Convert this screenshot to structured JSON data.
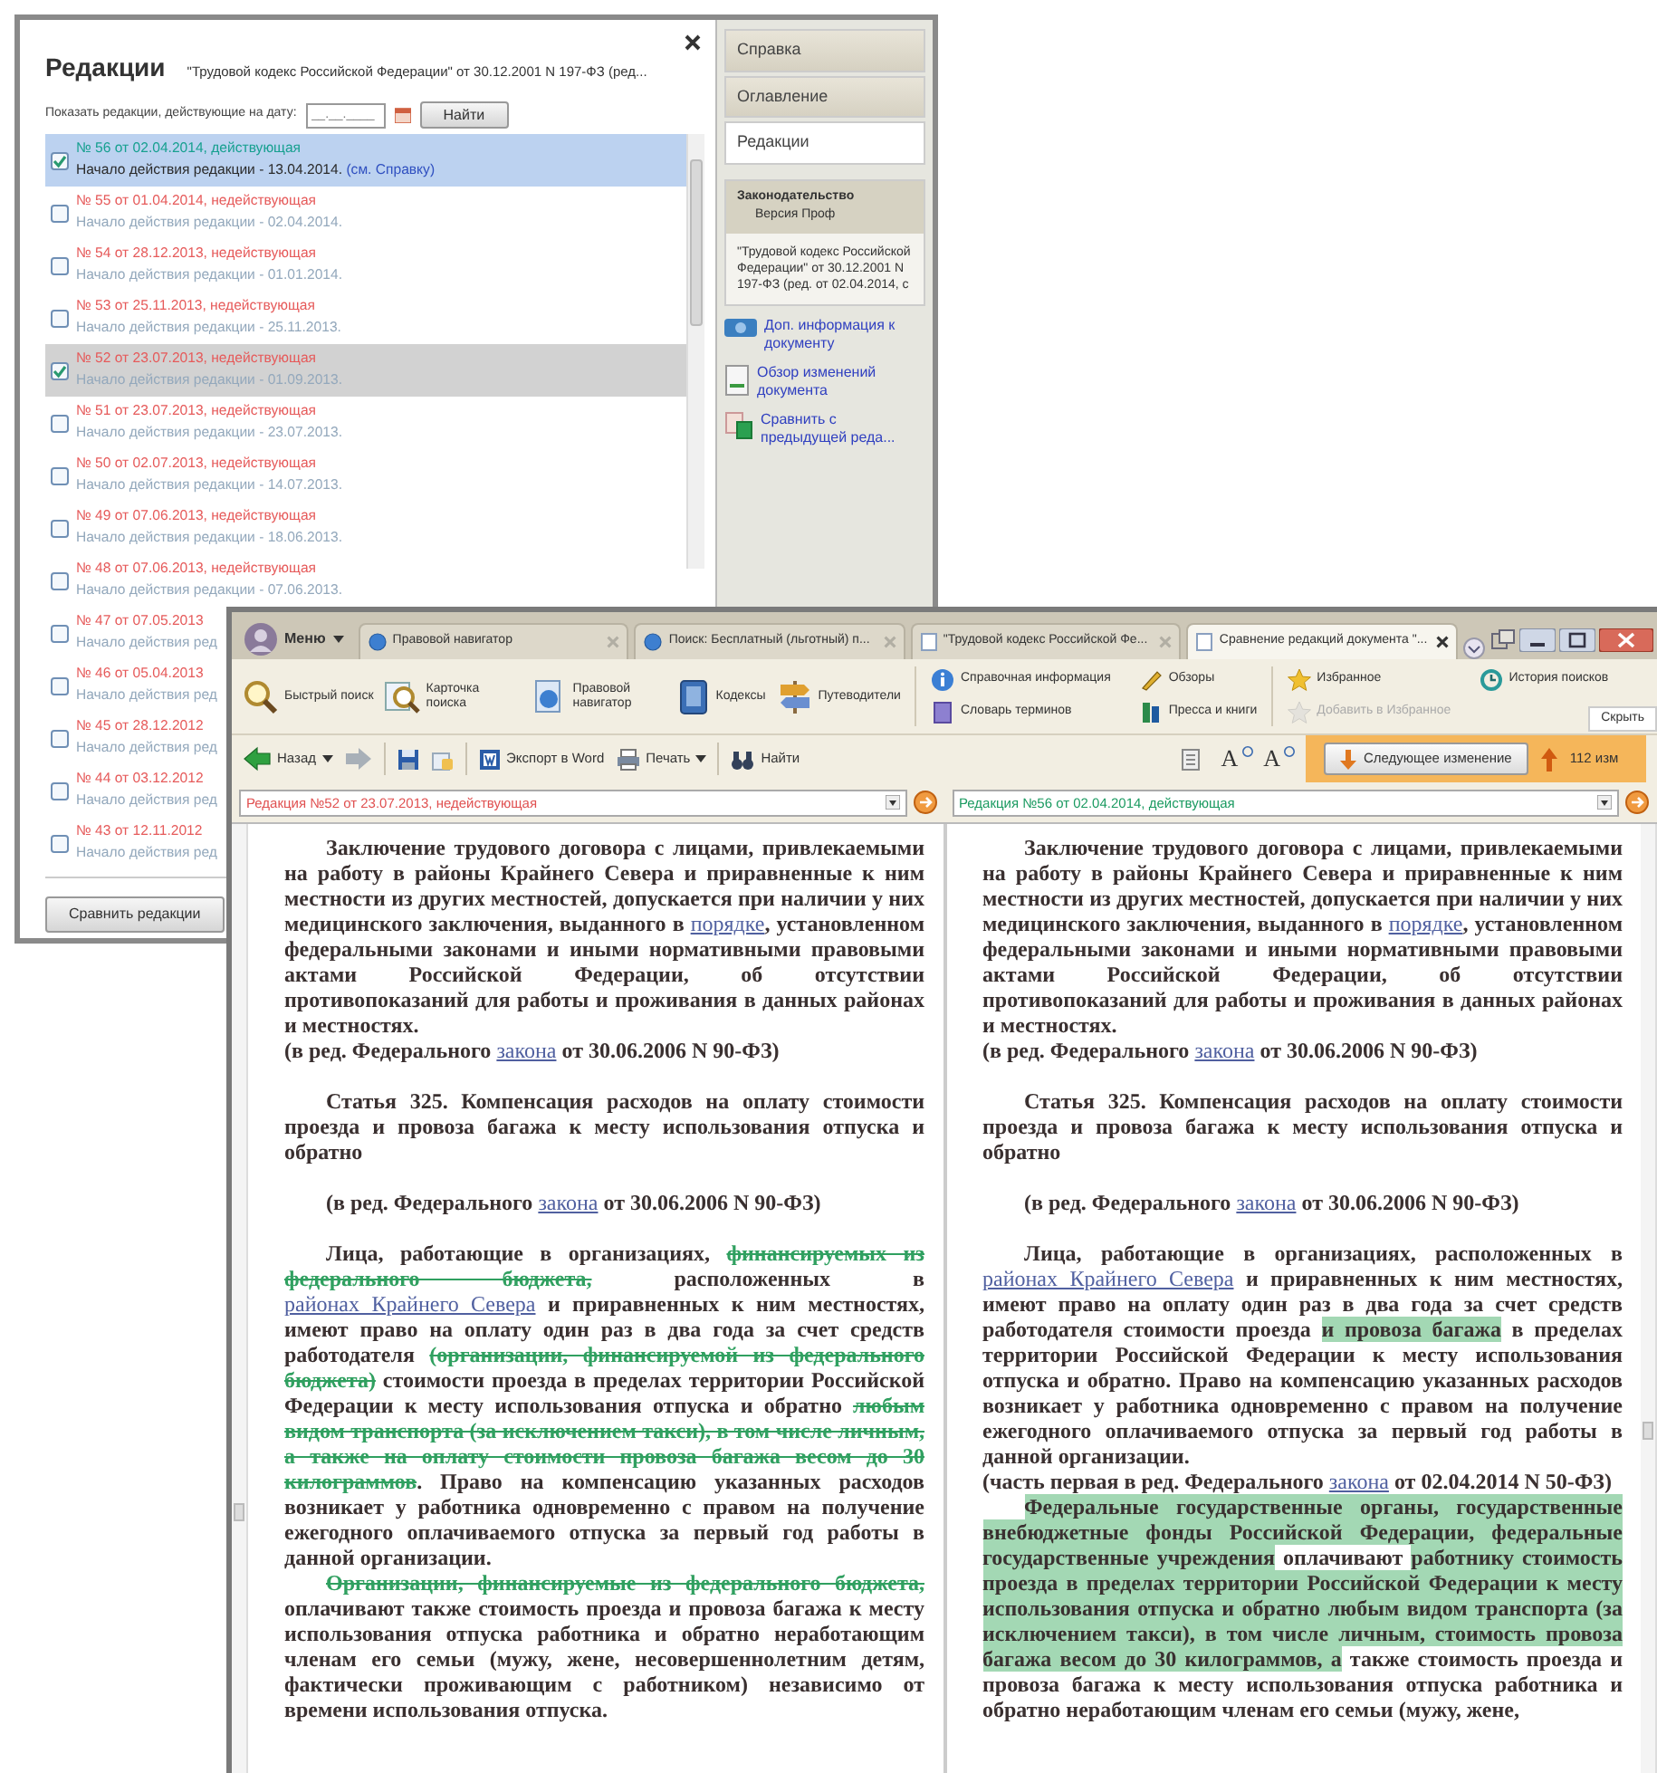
{
  "back_window": {
    "title": "Редакции",
    "document_title": "\"Трудовой кодекс Российской Федерации\" от 30.12.2001 N 197-ФЗ (ред...",
    "filter": {
      "label": "Показать редакции, действующие на дату:",
      "placeholder": "__.__.____",
      "button": "Найти"
    },
    "editions": [
      {
        "title": "№ 56 от 02.04.2014, действующая",
        "start": "Начало действия редакции - 13.04.2014.",
        "note": "(см. Справку)",
        "current": true,
        "checked": true,
        "selected": true
      },
      {
        "title": "№ 55 от 01.04.2014, недействующая",
        "start": "Начало действия редакции - 02.04.2014.",
        "current": false,
        "checked": false,
        "selected": false
      },
      {
        "title": "№ 54 от 28.12.2013, недействующая",
        "start": "Начало действия редакции - 01.01.2014.",
        "current": false,
        "checked": false,
        "selected": false
      },
      {
        "title": "№ 53 от 25.11.2013, недействующая",
        "start": "Начало действия редакции - 25.11.2013.",
        "current": false,
        "checked": false,
        "selected": false
      },
      {
        "title": "№ 52 от 23.07.2013, недействующая",
        "start": "Начало действия редакции - 01.09.2013.",
        "current": false,
        "checked": true,
        "selected": false
      },
      {
        "title": "№ 51 от 23.07.2013, недействующая",
        "start": "Начало действия редакции - 23.07.2013.",
        "current": false,
        "checked": false,
        "selected": false
      },
      {
        "title": "№ 50 от 02.07.2013, недействующая",
        "start": "Начало действия редакции - 14.07.2013.",
        "current": false,
        "checked": false,
        "selected": false
      },
      {
        "title": "№ 49 от 07.06.2013, недействующая",
        "start": "Начало действия редакции - 18.06.2013.",
        "current": false,
        "checked": false,
        "selected": false
      },
      {
        "title": "№ 48 от 07.06.2013, недействующая",
        "start": "Начало действия редакции - 07.06.2013.",
        "current": false,
        "checked": false,
        "selected": false
      },
      {
        "title": "№ 47 от 07.05.2013",
        "start": "Начало действия ред",
        "current": false,
        "checked": false,
        "selected": false
      },
      {
        "title": "№ 46 от 05.04.2013",
        "start": "Начало действия ред",
        "current": false,
        "checked": false,
        "selected": false
      },
      {
        "title": "№ 45 от 28.12.2012",
        "start": "Начало действия ред",
        "current": false,
        "checked": false,
        "selected": false
      },
      {
        "title": "№ 44 от 03.12.2012",
        "start": "Начало действия ред",
        "current": false,
        "checked": false,
        "selected": false
      },
      {
        "title": "№ 43 от 12.11.2012",
        "start": "Начало действия ред",
        "current": false,
        "checked": false,
        "selected": false
      }
    ],
    "compare_button": "Сравнить редакции",
    "side_tabs": [
      {
        "label": "Справка",
        "selected": false
      },
      {
        "label": "Оглавление",
        "selected": false
      },
      {
        "label": "Редакции",
        "selected": true
      }
    ],
    "info": {
      "header": "Законодательство",
      "subheader": "Версия Проф",
      "text": "\"Трудовой кодекс Российской Федерации\" от 30.12.2001 N 197-ФЗ (ред. от 02.04.2014, с"
    },
    "links": [
      "Доп. информация к документу",
      "Обзор изменений документа",
      "Сравнить с предыдущей реда..."
    ]
  },
  "main_window": {
    "menu_button": "Меню",
    "tabs": [
      {
        "label": "Правовой навигатор",
        "selected": false
      },
      {
        "label": "Поиск: Бесплатный (льготный) п...",
        "selected": false
      },
      {
        "label": "\"Трудовой кодекс Российской Фе...",
        "selected": false
      },
      {
        "label": "Сравнение редакций документа \"...",
        "selected": true
      }
    ],
    "ribbon": {
      "large": [
        "Быстрый поиск",
        "Карточка поиска",
        "Правовой навигатор",
        "Кодексы",
        "Путеводители"
      ],
      "small": [
        {
          "label": "Справочная информация",
          "disabled": false
        },
        {
          "label": "Словарь терминов",
          "disabled": false
        },
        {
          "label": "Обзоры",
          "disabled": false
        },
        {
          "label": "Пресса и книги",
          "disabled": false
        },
        {
          "label": "Избранное",
          "disabled": false
        },
        {
          "label": "Добавить в Избранное",
          "disabled": true
        },
        {
          "label": "История поисков",
          "disabled": false
        }
      ],
      "hide": "Скрыть"
    },
    "toolbar": {
      "back": "Назад",
      "export": "Экспорт в Word",
      "print": "Печать",
      "find": "Найти",
      "font_buttons": [
        "A",
        "A"
      ],
      "next_change": "Следующее изменение",
      "changes_count": "112 изм"
    },
    "panes": [
      {
        "edition": "Редакция №52 от 23.07.2013, недействующая",
        "current": false,
        "paragraphs": [
          {
            "indent": true,
            "gap_before": false,
            "parts": [
              {
                "kind": "text",
                "text": "Заключение трудового договора с лицами, привлекаемыми на работу в районы Крайнего Севера и приравненные к ним местности из других местностей, допускается при наличии у них медицинского заключения, выданного в "
              },
              {
                "kind": "link",
                "text": "порядке"
              },
              {
                "kind": "text",
                "text": ", установленном федеральными законами и иными нормативными правовыми актами Российской Федерации, об отсутствии противопоказаний для работы и проживания в данных районах и местностях."
              }
            ]
          },
          {
            "indent": false,
            "gap_before": false,
            "parts": [
              {
                "kind": "text",
                "text": "(в ред. Федерального "
              },
              {
                "kind": "link",
                "text": "закона"
              },
              {
                "kind": "text",
                "text": " от 30.06.2006 N 90-ФЗ)"
              }
            ]
          },
          {
            "indent": true,
            "gap_before": true,
            "parts": [
              {
                "kind": "text",
                "text": "Статья 325. Компенсация расходов на оплату стоимости проезда и провоза багажа к месту использования отпуска и обратно"
              }
            ]
          },
          {
            "indent": true,
            "gap_before": true,
            "parts": [
              {
                "kind": "text",
                "text": "(в ред. Федерального "
              },
              {
                "kind": "link",
                "text": "закона"
              },
              {
                "kind": "text",
                "text": " от 30.06.2006 N 90-ФЗ)"
              }
            ]
          },
          {
            "indent": true,
            "gap_before": true,
            "parts": [
              {
                "kind": "text",
                "text": "Лица, работающие в организациях, "
              },
              {
                "kind": "deleted",
                "text": "финансируемых из федерального бюджета,"
              },
              {
                "kind": "text",
                "text": " расположенных в "
              },
              {
                "kind": "link",
                "text": "районах Крайнего Севера"
              },
              {
                "kind": "text",
                "text": " и приравненных к ним местностях, имеют право на оплату один раз в два года за счет средств работодателя "
              },
              {
                "kind": "deleted",
                "text": "(организации, финансируемой из федерального бюджета)"
              },
              {
                "kind": "text",
                "text": " стоимости проезда в пределах территории Российской Федерации к месту использования отпуска и обратно "
              },
              {
                "kind": "deleted",
                "text": "любым видом транспорта (за исключением такси), в том числе личным, а также на оплату стоимости провоза багажа весом до 30 килограммов"
              },
              {
                "kind": "text",
                "text": ". Право на компенсацию указанных расходов возникает у работника одновременно с правом на получение ежегодного оплачиваемого отпуска за первый год работы в данной организации."
              }
            ]
          },
          {
            "indent": true,
            "gap_before": false,
            "parts": [
              {
                "kind": "deleted",
                "text": "Организации, финансируемые из федерального бюджета,"
              },
              {
                "kind": "text",
                "text": " оплачивают также стоимость проезда и провоза багажа к месту использования отпуска работника и обратно неработающим членам его семьи (мужу, жене, несовершеннолетним детям, фактически проживающим с работником) независимо от времени использования отпуска."
              }
            ]
          }
        ]
      },
      {
        "edition": "Редакция №56 от 02.04.2014, действующая",
        "current": true,
        "paragraphs": [
          {
            "indent": true,
            "gap_before": false,
            "parts": [
              {
                "kind": "text",
                "text": "Заключение трудового договора с лицами, привлекаемыми на работу в районы Крайнего Севера и приравненные к ним местности из других местностей, допускается при наличии у них медицинского заключения, выданного в "
              },
              {
                "kind": "link",
                "text": "порядке"
              },
              {
                "kind": "text",
                "text": ", установленном федеральными законами и иными нормативными правовыми актами Российской Федерации, об отсутствии противопоказаний для работы и проживания в данных районах и местностях."
              }
            ]
          },
          {
            "indent": false,
            "gap_before": false,
            "parts": [
              {
                "kind": "text",
                "text": "(в ред. Федерального "
              },
              {
                "kind": "link",
                "text": "закона"
              },
              {
                "kind": "text",
                "text": " от 30.06.2006 N 90-ФЗ)"
              }
            ]
          },
          {
            "indent": true,
            "gap_before": true,
            "parts": [
              {
                "kind": "text",
                "text": "Статья 325. Компенсация расходов на оплату стоимости проезда и провоза багажа к месту использования отпуска и обратно"
              }
            ]
          },
          {
            "indent": true,
            "gap_before": true,
            "parts": [
              {
                "kind": "text",
                "text": "(в ред. Федерального "
              },
              {
                "kind": "link",
                "text": "закона"
              },
              {
                "kind": "text",
                "text": " от 30.06.2006 N 90-ФЗ)"
              }
            ]
          },
          {
            "indent": true,
            "gap_before": true,
            "parts": [
              {
                "kind": "text",
                "text": "Лица, работающие в организациях, расположенных в "
              },
              {
                "kind": "link",
                "text": "районах Крайнего Севера"
              },
              {
                "kind": "text",
                "text": " и приравненных к ним местностях, имеют право на оплату один раз в два года за счет средств работодателя стоимости проезда "
              },
              {
                "kind": "added",
                "text": "и провоза багажа"
              },
              {
                "kind": "text",
                "text": " в пределах территории Российской Федерации к месту использования отпуска и обратно. Право на компенсацию указанных расходов возникает у работника одновременно с правом на получение ежегодного оплачиваемого отпуска за первый год работы в данной организации."
              }
            ]
          },
          {
            "indent": false,
            "gap_before": false,
            "parts": [
              {
                "kind": "text",
                "text": "(часть первая в ред. Федерального "
              },
              {
                "kind": "link",
                "text": "закона"
              },
              {
                "kind": "text",
                "text": " от 02.04.2014 N 50-ФЗ)"
              }
            ]
          },
          {
            "indent": true,
            "gap_before": false,
            "parts": [
              {
                "kind": "added",
                "text": "Федеральные государственные органы, государственные внебюджетные фонды Российской Федерации, федеральные государственные учреждения"
              },
              {
                "kind": "text",
                "text": " оплачивают "
              },
              {
                "kind": "added",
                "text": "работнику стоимость проезда в пределах территории Российской Федерации к месту использования отпуска и обратно любым видом транспорта (за исключением такси), в том числе личным, стоимость провоза багажа весом до 30 килограммов, а"
              },
              {
                "kind": "text",
                "text": " также стоимость проезда и провоза багажа к месту использования отпуска работника и обратно неработающим членам его семьи (мужу, жене,"
              }
            ]
          }
        ]
      }
    ]
  }
}
